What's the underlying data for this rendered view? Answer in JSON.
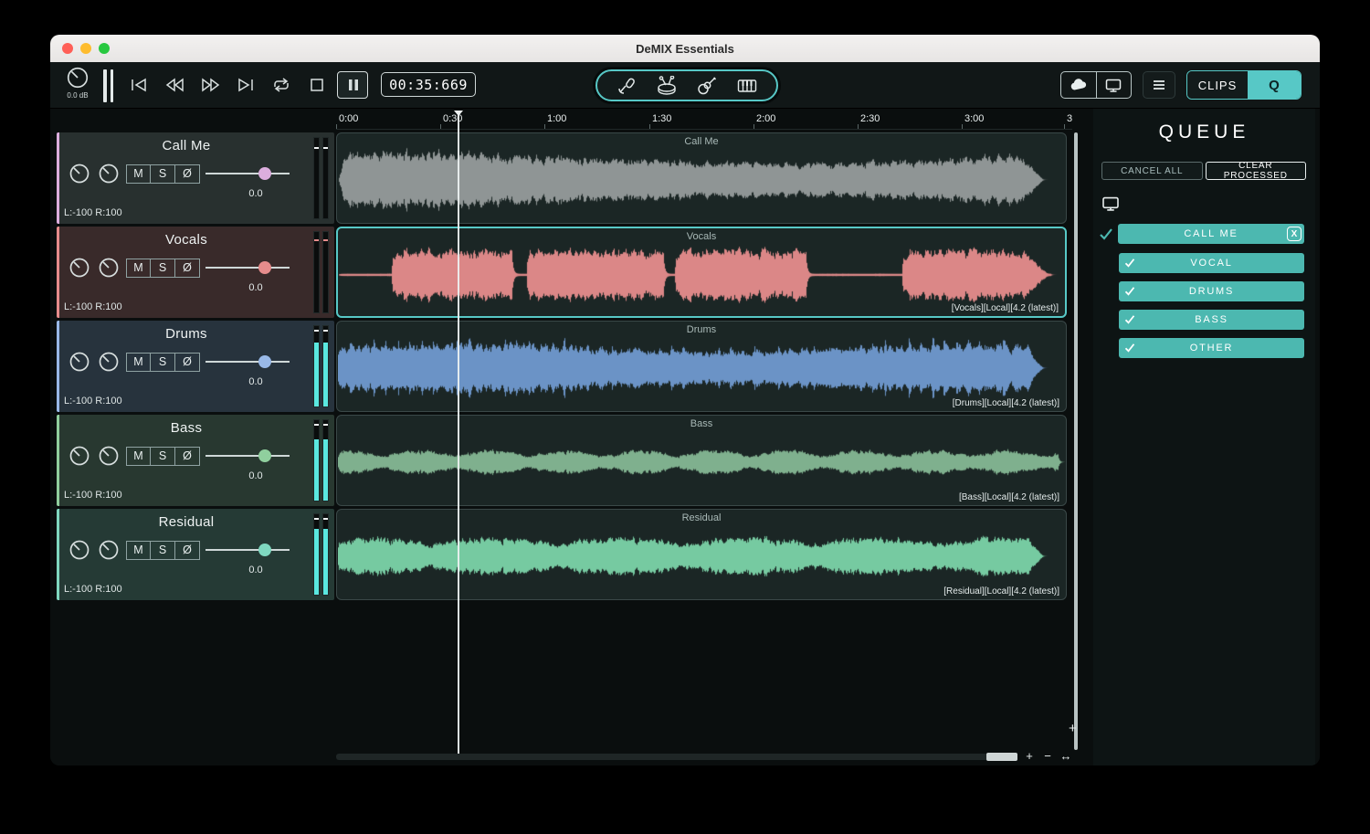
{
  "colors": {
    "accent": "#57c8c6",
    "queue_pill": "#4cb8b0",
    "meter": "#5ae8e0"
  },
  "window": {
    "title": "DeMIX Essentials"
  },
  "toolbar": {
    "db_label": "0.0 dB",
    "time_display": "00:35:669",
    "instrument_icons": [
      "microphone-icon",
      "drums-icon",
      "guitar-icon",
      "piano-icon"
    ],
    "clips_label": "CLIPS",
    "queue_label": "Q"
  },
  "timeline": {
    "ticks": [
      "0:00",
      "0:30",
      "1:00",
      "1:30",
      "2:00",
      "2:30",
      "3:00",
      "3"
    ]
  },
  "controls": {
    "mute": "M",
    "solo": "S",
    "phase": "Ø"
  },
  "tracks": [
    {
      "name": "Call Me",
      "region_label": "Call Me",
      "caption": "",
      "gain": "0.0",
      "pan": "L:-100 R:100",
      "color": "#969b9b",
      "accent": "#dcaede",
      "header_tint": "#28302f",
      "selected": false
    },
    {
      "name": "Vocals",
      "region_label": "Vocals",
      "caption": "[Vocals][Local][4.2 (latest)]",
      "gain": "0.0",
      "pan": "L:-100 R:100",
      "color": "#e68c8c",
      "accent": "#e68c8c",
      "header_tint": "#392a2a",
      "selected": true
    },
    {
      "name": "Drums",
      "region_label": "Drums",
      "caption": "[Drums][Local][4.2 (latest)]",
      "gain": "0.0",
      "pan": "L:-100 R:100",
      "color": "#7099cf",
      "accent": "#99b9e8",
      "header_tint": "#27333d",
      "selected": false
    },
    {
      "name": "Bass",
      "region_label": "Bass",
      "caption": "[Bass][Local][4.2 (latest)]",
      "gain": "0.0",
      "pan": "L:-100 R:100",
      "color": "#85b794",
      "accent": "#90cf9e",
      "header_tint": "#283830",
      "selected": false
    },
    {
      "name": "Residual",
      "region_label": "Residual",
      "caption": "[Residual][Local][4.2 (latest)]",
      "gain": "0.0",
      "pan": "L:-100 R:100",
      "color": "#7bd3a8",
      "accent": "#7fd8c0",
      "header_tint": "#253a35",
      "selected": false
    }
  ],
  "queue": {
    "title": "QUEUE",
    "cancel_all_label": "CANCEL ALL",
    "clear_processed_label": "CLEAR PROCESSED",
    "job": {
      "name": "CALL ME",
      "close_label": "X",
      "stems": [
        "VOCAL",
        "DRUMS",
        "BASS",
        "OTHER"
      ]
    }
  },
  "zoom": {
    "in": "+",
    "out": "−",
    "horizontal": "↔",
    "add_track": "+"
  }
}
